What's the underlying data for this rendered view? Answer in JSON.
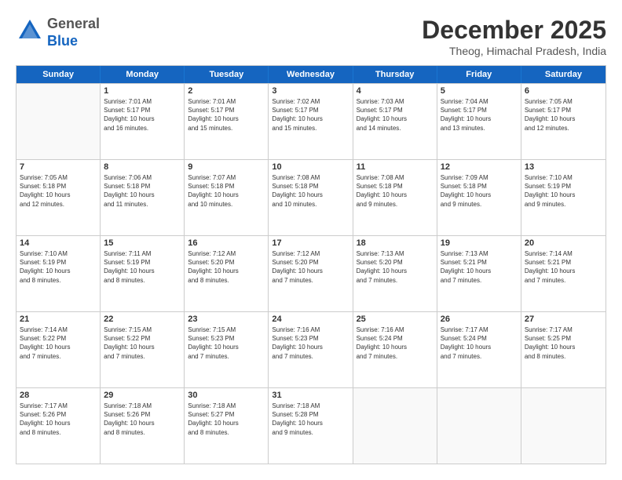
{
  "logo": {
    "general": "General",
    "blue": "Blue"
  },
  "title": "December 2025",
  "location": "Theog, Himachal Pradesh, India",
  "header_days": [
    "Sunday",
    "Monday",
    "Tuesday",
    "Wednesday",
    "Thursday",
    "Friday",
    "Saturday"
  ],
  "rows": [
    [
      {
        "day": "",
        "info": ""
      },
      {
        "day": "1",
        "info": "Sunrise: 7:01 AM\nSunset: 5:17 PM\nDaylight: 10 hours\nand 16 minutes."
      },
      {
        "day": "2",
        "info": "Sunrise: 7:01 AM\nSunset: 5:17 PM\nDaylight: 10 hours\nand 15 minutes."
      },
      {
        "day": "3",
        "info": "Sunrise: 7:02 AM\nSunset: 5:17 PM\nDaylight: 10 hours\nand 15 minutes."
      },
      {
        "day": "4",
        "info": "Sunrise: 7:03 AM\nSunset: 5:17 PM\nDaylight: 10 hours\nand 14 minutes."
      },
      {
        "day": "5",
        "info": "Sunrise: 7:04 AM\nSunset: 5:17 PM\nDaylight: 10 hours\nand 13 minutes."
      },
      {
        "day": "6",
        "info": "Sunrise: 7:05 AM\nSunset: 5:17 PM\nDaylight: 10 hours\nand 12 minutes."
      }
    ],
    [
      {
        "day": "7",
        "info": "Sunrise: 7:05 AM\nSunset: 5:18 PM\nDaylight: 10 hours\nand 12 minutes."
      },
      {
        "day": "8",
        "info": "Sunrise: 7:06 AM\nSunset: 5:18 PM\nDaylight: 10 hours\nand 11 minutes."
      },
      {
        "day": "9",
        "info": "Sunrise: 7:07 AM\nSunset: 5:18 PM\nDaylight: 10 hours\nand 10 minutes."
      },
      {
        "day": "10",
        "info": "Sunrise: 7:08 AM\nSunset: 5:18 PM\nDaylight: 10 hours\nand 10 minutes."
      },
      {
        "day": "11",
        "info": "Sunrise: 7:08 AM\nSunset: 5:18 PM\nDaylight: 10 hours\nand 9 minutes."
      },
      {
        "day": "12",
        "info": "Sunrise: 7:09 AM\nSunset: 5:18 PM\nDaylight: 10 hours\nand 9 minutes."
      },
      {
        "day": "13",
        "info": "Sunrise: 7:10 AM\nSunset: 5:19 PM\nDaylight: 10 hours\nand 9 minutes."
      }
    ],
    [
      {
        "day": "14",
        "info": "Sunrise: 7:10 AM\nSunset: 5:19 PM\nDaylight: 10 hours\nand 8 minutes."
      },
      {
        "day": "15",
        "info": "Sunrise: 7:11 AM\nSunset: 5:19 PM\nDaylight: 10 hours\nand 8 minutes."
      },
      {
        "day": "16",
        "info": "Sunrise: 7:12 AM\nSunset: 5:20 PM\nDaylight: 10 hours\nand 8 minutes."
      },
      {
        "day": "17",
        "info": "Sunrise: 7:12 AM\nSunset: 5:20 PM\nDaylight: 10 hours\nand 7 minutes."
      },
      {
        "day": "18",
        "info": "Sunrise: 7:13 AM\nSunset: 5:20 PM\nDaylight: 10 hours\nand 7 minutes."
      },
      {
        "day": "19",
        "info": "Sunrise: 7:13 AM\nSunset: 5:21 PM\nDaylight: 10 hours\nand 7 minutes."
      },
      {
        "day": "20",
        "info": "Sunrise: 7:14 AM\nSunset: 5:21 PM\nDaylight: 10 hours\nand 7 minutes."
      }
    ],
    [
      {
        "day": "21",
        "info": "Sunrise: 7:14 AM\nSunset: 5:22 PM\nDaylight: 10 hours\nand 7 minutes."
      },
      {
        "day": "22",
        "info": "Sunrise: 7:15 AM\nSunset: 5:22 PM\nDaylight: 10 hours\nand 7 minutes."
      },
      {
        "day": "23",
        "info": "Sunrise: 7:15 AM\nSunset: 5:23 PM\nDaylight: 10 hours\nand 7 minutes."
      },
      {
        "day": "24",
        "info": "Sunrise: 7:16 AM\nSunset: 5:23 PM\nDaylight: 10 hours\nand 7 minutes."
      },
      {
        "day": "25",
        "info": "Sunrise: 7:16 AM\nSunset: 5:24 PM\nDaylight: 10 hours\nand 7 minutes."
      },
      {
        "day": "26",
        "info": "Sunrise: 7:17 AM\nSunset: 5:24 PM\nDaylight: 10 hours\nand 7 minutes."
      },
      {
        "day": "27",
        "info": "Sunrise: 7:17 AM\nSunset: 5:25 PM\nDaylight: 10 hours\nand 8 minutes."
      }
    ],
    [
      {
        "day": "28",
        "info": "Sunrise: 7:17 AM\nSunset: 5:26 PM\nDaylight: 10 hours\nand 8 minutes."
      },
      {
        "day": "29",
        "info": "Sunrise: 7:18 AM\nSunset: 5:26 PM\nDaylight: 10 hours\nand 8 minutes."
      },
      {
        "day": "30",
        "info": "Sunrise: 7:18 AM\nSunset: 5:27 PM\nDaylight: 10 hours\nand 8 minutes."
      },
      {
        "day": "31",
        "info": "Sunrise: 7:18 AM\nSunset: 5:28 PM\nDaylight: 10 hours\nand 9 minutes."
      },
      {
        "day": "",
        "info": ""
      },
      {
        "day": "",
        "info": ""
      },
      {
        "day": "",
        "info": ""
      }
    ]
  ]
}
